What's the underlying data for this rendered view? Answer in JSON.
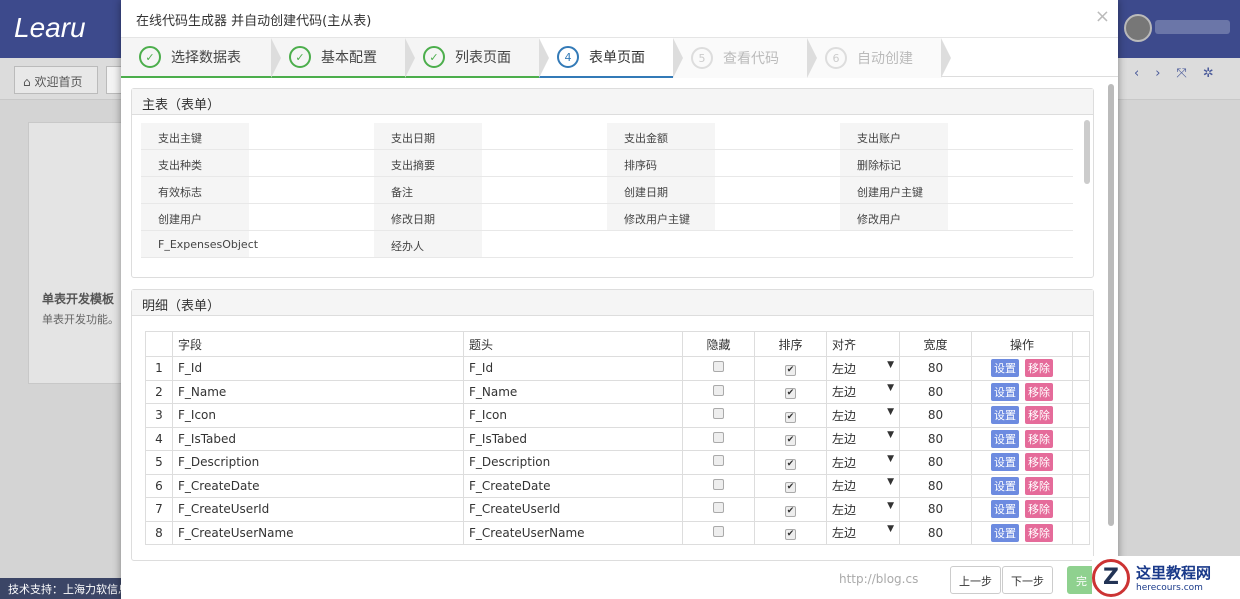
{
  "app": {
    "logo": "Learu",
    "home_tab": "欢迎首页",
    "bg_card_title": "单表开发模板",
    "bg_card_desc": "单表开发功能。",
    "footer": "技术支持：上海力软信息"
  },
  "modal": {
    "title": "在线代码生成器 并自动创建代码(主从表)",
    "close": "×",
    "steps": [
      {
        "num": "✓",
        "label": "选择数据表",
        "state": "done"
      },
      {
        "num": "✓",
        "label": "基本配置",
        "state": "done"
      },
      {
        "num": "✓",
        "label": "列表页面",
        "state": "done"
      },
      {
        "num": "4",
        "label": "表单页面",
        "state": "active"
      },
      {
        "num": "5",
        "label": "查看代码",
        "state": "todo"
      },
      {
        "num": "6",
        "label": "自动创建",
        "state": "todo"
      }
    ],
    "main_panel": {
      "title": "主表（表单）",
      "fields": [
        "支出主键",
        "支出日期",
        "支出金额",
        "支出账户",
        "支出种类",
        "支出摘要",
        "排序码",
        "删除标记",
        "有效标志",
        "备注",
        "创建日期",
        "创建用户主键",
        "创建用户",
        "修改日期",
        "修改用户主键",
        "修改用户",
        "F_ExpensesObject",
        "经办人"
      ]
    },
    "detail_panel": {
      "title": "明细（表单）",
      "headers": [
        "",
        "字段",
        "题头",
        "隐藏",
        "排序",
        "对齐",
        "宽度",
        "操作",
        ""
      ],
      "rows": [
        {
          "n": "1",
          "field": "F_Id",
          "title": "F_Id",
          "hidden": false,
          "sort": true,
          "align": "左边",
          "width": "80"
        },
        {
          "n": "2",
          "field": "F_Name",
          "title": "F_Name",
          "hidden": false,
          "sort": true,
          "align": "左边",
          "width": "80"
        },
        {
          "n": "3",
          "field": "F_Icon",
          "title": "F_Icon",
          "hidden": false,
          "sort": true,
          "align": "左边",
          "width": "80"
        },
        {
          "n": "4",
          "field": "F_IsTabed",
          "title": "F_IsTabed",
          "hidden": false,
          "sort": true,
          "align": "左边",
          "width": "80"
        },
        {
          "n": "5",
          "field": "F_Description",
          "title": "F_Description",
          "hidden": false,
          "sort": true,
          "align": "左边",
          "width": "80"
        },
        {
          "n": "6",
          "field": "F_CreateDate",
          "title": "F_CreateDate",
          "hidden": false,
          "sort": true,
          "align": "左边",
          "width": "80"
        },
        {
          "n": "7",
          "field": "F_CreateUserId",
          "title": "F_CreateUserId",
          "hidden": false,
          "sort": true,
          "align": "左边",
          "width": "80"
        },
        {
          "n": "8",
          "field": "F_CreateUserName",
          "title": "F_CreateUserName",
          "hidden": false,
          "sort": true,
          "align": "左边",
          "width": "80"
        }
      ],
      "set_label": "设置",
      "remove_label": "移除"
    },
    "buttons": {
      "prev": "上一步",
      "next": "下一步",
      "finish": "完"
    }
  },
  "watermarks": {
    "blog": "http://blog.cs",
    "site": "这里教程网",
    "site_url": "herecours.com"
  }
}
